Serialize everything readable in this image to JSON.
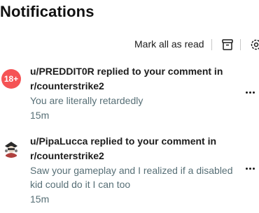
{
  "header": {
    "title": "Notifications",
    "mark_all_label": "Mark all as read",
    "archive_icon": "archive-icon",
    "settings_icon": "settings-icon"
  },
  "notifications": [
    {
      "avatar_badge": "18+",
      "avatar_color": "#f55355",
      "headline": "u/PREDDIT0R replied to your comment in r/counterstrike2",
      "body": "You are literally retardedly",
      "time": "15m"
    },
    {
      "avatar_icon": "user-avatar-icon",
      "headline": "u/PipaLucca replied to your comment in r/counterstrike2",
      "body": "Saw your gameplay and I realized if a disabled kid could do it I can too",
      "time": "15m"
    }
  ],
  "colors": {
    "primary_text": "#1c1c1c",
    "secondary_text": "#576f76",
    "badge_red": "#f55355"
  }
}
